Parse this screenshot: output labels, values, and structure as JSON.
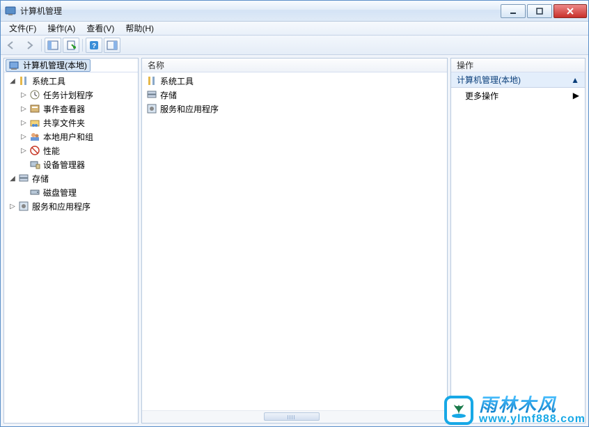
{
  "window": {
    "title": "计算机管理"
  },
  "menu": {
    "file": "文件(F)",
    "action": "操作(A)",
    "view": "查看(V)",
    "help": "帮助(H)"
  },
  "tree": {
    "root": "计算机管理(本地)",
    "system_tools": "系统工具",
    "task_scheduler": "任务计划程序",
    "event_viewer": "事件查看器",
    "shared_folders": "共享文件夹",
    "local_users": "本地用户和组",
    "performance": "性能",
    "device_manager": "设备管理器",
    "storage": "存储",
    "disk_management": "磁盘管理",
    "services_apps": "服务和应用程序"
  },
  "list": {
    "header": "名称",
    "items": {
      "system_tools": "系统工具",
      "storage": "存储",
      "services_apps": "服务和应用程序"
    }
  },
  "actions": {
    "header": "操作",
    "section": "计算机管理(本地)",
    "more": "更多操作"
  },
  "watermark": {
    "zh": "雨林木风",
    "url": "www.ylmf888.com"
  }
}
